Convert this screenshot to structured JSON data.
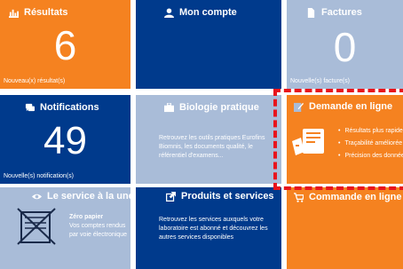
{
  "tiles": {
    "resultats": {
      "title": "Résultats",
      "number": "6",
      "footer": "Nouveau(x) résultat(s)"
    },
    "compte": {
      "title": "Mon compte"
    },
    "factures": {
      "title": "Factures",
      "number": "0",
      "footer": "Nouvelle(s) facture(s)"
    },
    "notifications": {
      "title": "Notifications",
      "number": "49",
      "footer": "Nouvelle(s) notification(s)"
    },
    "biologie": {
      "title": "Biologie pratique",
      "description": "Retrouvez les outils pratiques Eurofins Biomnis, les documents qualité, le référentiel d'examens..."
    },
    "demande": {
      "title": "Demande en ligne",
      "bullets": [
        "Résultats plus rapides",
        "Traçabilité améliorée",
        "Précision des données"
      ]
    },
    "service": {
      "title": "Le service à la une",
      "headline": "Zéro papier",
      "text": "Vos comptes rendus par voie électronique"
    },
    "produits": {
      "title": "Produits et services",
      "description": "Retrouvez les services auxquels votre laboratoire est abonné et découvrez les autres services disponibles"
    },
    "commande": {
      "title": "Commande en ligne"
    }
  },
  "colors": {
    "orange": "#f58220",
    "navy": "#003a8c",
    "light_blue": "#a9bcd8",
    "highlight": "#e8141c"
  },
  "icons": {
    "resultats": "bar-chart-icon",
    "compte": "user-icon",
    "factures": "document-icon",
    "notifications": "chat-icon",
    "biologie": "briefcase-icon",
    "demande": "edit-icon",
    "service": "eye-icon",
    "produits": "external-link-icon",
    "commande": "cart-icon"
  }
}
